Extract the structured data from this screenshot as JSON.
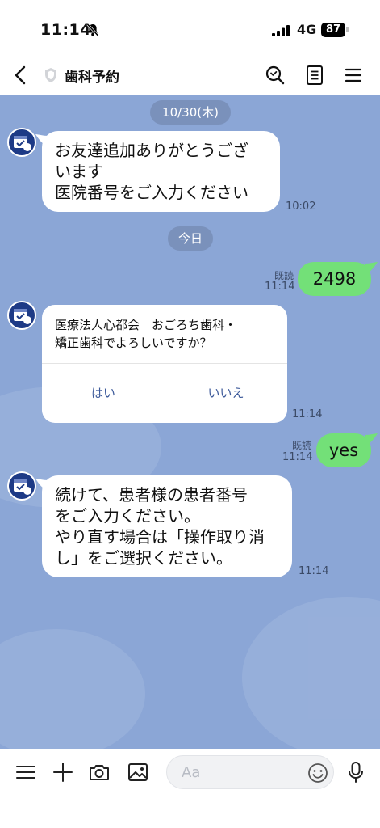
{
  "status_bar": {
    "time": "11:14",
    "network": "4G",
    "battery": "87",
    "icons": [
      "bell-slash-icon",
      "signal-icon"
    ]
  },
  "header": {
    "title": "歯科予約",
    "icons": [
      "back-icon",
      "shield-icon",
      "search-icon",
      "notes-icon",
      "menu-icon"
    ]
  },
  "chat": {
    "background_color": "#8ba6d6",
    "dates": [
      "10/30(木)",
      "今日"
    ],
    "messages": [
      {
        "side": "in",
        "text": "お友達追加ありがとうござ\nいます\n医院番号をご入力ください",
        "time": "10:02"
      },
      {
        "side": "out",
        "text": "2498",
        "read": "既読",
        "time": "11:14"
      },
      {
        "side": "in",
        "type": "confirm",
        "text": "医療法人心都会　おごろち歯科・\n矯正歯科でよろしいですか？",
        "options": [
          "はい",
          "いいえ"
        ],
        "time": "11:14"
      },
      {
        "side": "out",
        "text": "yes",
        "read": "既読",
        "time": "11:14"
      },
      {
        "side": "in",
        "text": "続けて、患者様の患者番号\nをご入力ください。\nやり直す場合は「操作取り消\nし」をご選択ください。",
        "time": "11:14"
      }
    ]
  },
  "input": {
    "placeholder": "Aa",
    "icons": [
      "menu-icon",
      "plus-icon",
      "camera-icon",
      "image-icon",
      "emoji-icon",
      "mic-icon"
    ]
  },
  "colors": {
    "outgoing_bubble": "#73e078",
    "incoming_bubble": "#ffffff",
    "avatar": "#1d3a86"
  }
}
